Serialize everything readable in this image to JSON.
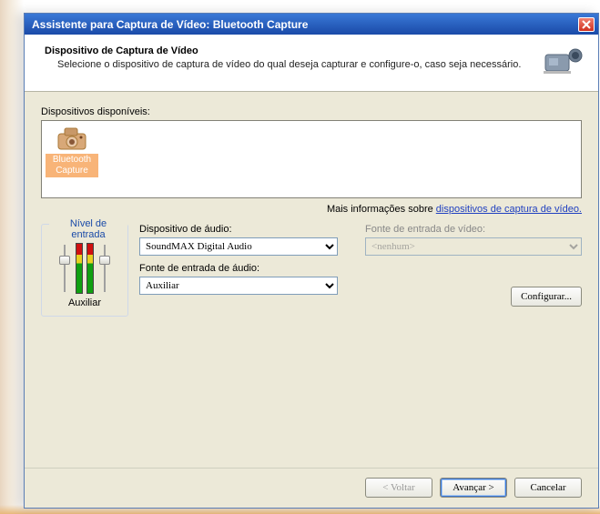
{
  "window": {
    "title": "Assistente para Captura de Vídeo: Bluetooth Capture"
  },
  "header": {
    "title": "Dispositivo de Captura de Vídeo",
    "subtitle": "Selecione o dispositivo de captura de vídeo do qual deseja capturar e configure-o, caso seja necessário."
  },
  "devices": {
    "label": "Dispositivos disponíveis:",
    "items": [
      {
        "name": "Bluetooth Capture"
      }
    ],
    "more_info_prefix": "Mais informações sobre ",
    "more_info_link": "dispositivos de captura de vídeo."
  },
  "input_level": {
    "legend": "Nível de entrada",
    "label": "Auxiliar"
  },
  "audio": {
    "device_label": "Dispositivo de áudio:",
    "device_value": "SoundMAX Digital Audio",
    "source_label": "Fonte de entrada de áudio:",
    "source_value": "Auxiliar"
  },
  "video": {
    "source_label": "Fonte de entrada de vídeo:",
    "source_value": "<nenhum>",
    "configure_label": "Configurar..."
  },
  "footer": {
    "back": "< Voltar",
    "next": "Avançar >",
    "cancel": "Cancelar"
  }
}
